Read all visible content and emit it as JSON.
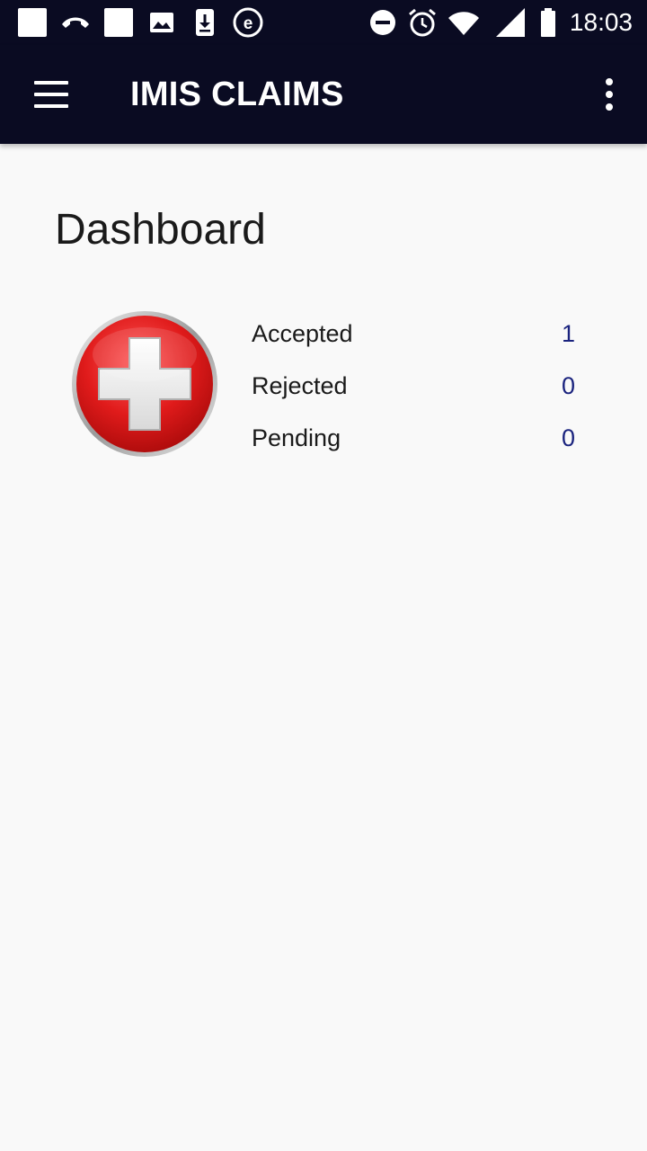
{
  "status_bar": {
    "time": "18:03",
    "left_icons": [
      "notification-square-icon",
      "missed-call-icon",
      "notification-square-icon",
      "image-icon",
      "download-icon",
      "browser-e-icon"
    ],
    "right_icons": [
      "do-not-disturb-icon",
      "alarm-icon",
      "wifi-icon",
      "signal-icon",
      "battery-icon"
    ]
  },
  "app_bar": {
    "title": "IMIS CLAIMS",
    "background": "#0a0b22"
  },
  "dashboard": {
    "title": "Dashboard",
    "stats": [
      {
        "label": "Accepted",
        "value": "1"
      },
      {
        "label": "Rejected",
        "value": "0"
      },
      {
        "label": "Pending",
        "value": "0"
      }
    ],
    "value_color": "#1a237e",
    "logo": "red-cross-icon"
  }
}
